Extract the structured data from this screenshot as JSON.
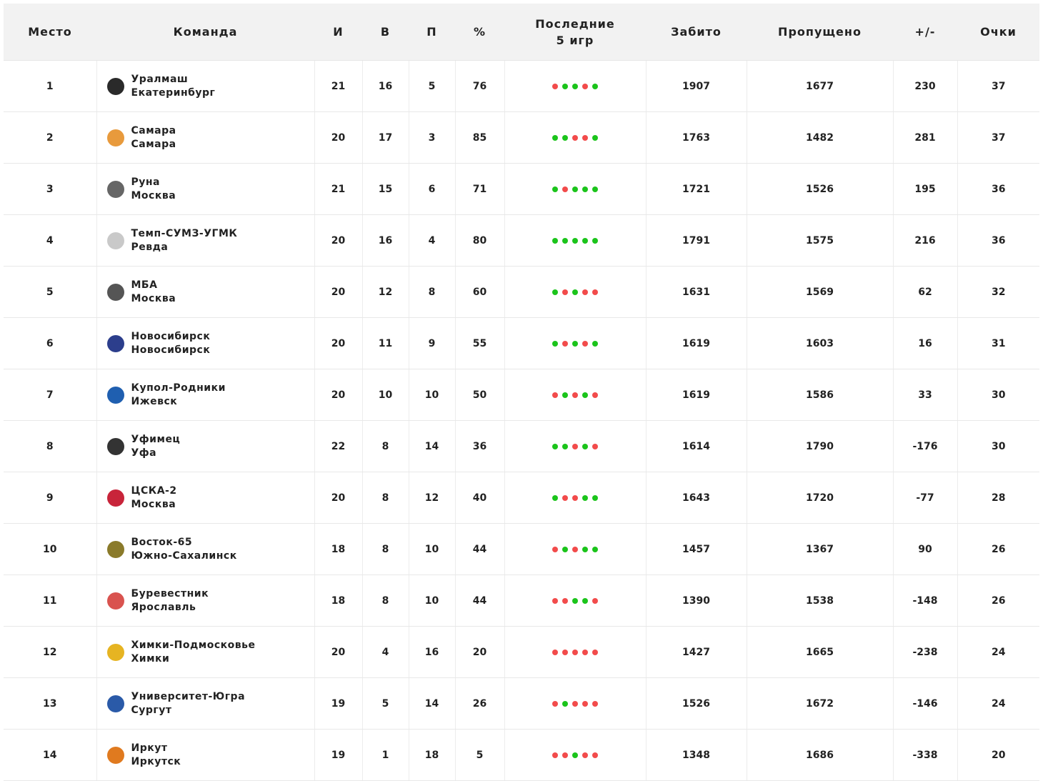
{
  "headers": [
    "Место",
    "Команда",
    "И",
    "В",
    "П",
    "%",
    "Последние 5 игр",
    "Забито",
    "Пропущено",
    "+/-",
    "Очки"
  ],
  "colors": {
    "win": "#1bc41b",
    "loss": "#f24b4b"
  },
  "rows": [
    {
      "place": "1",
      "name": "Уралмаш",
      "city": "Екатеринбург",
      "g": "21",
      "w": "16",
      "l": "5",
      "pct": "76",
      "last": "LWWLW",
      "scored": "1907",
      "conceded": "1677",
      "diff": "230",
      "pts": "37",
      "logo": "#2a2a2a"
    },
    {
      "place": "2",
      "name": "Самара",
      "city": "Самара",
      "g": "20",
      "w": "17",
      "l": "3",
      "pct": "85",
      "last": "WWLLW",
      "scored": "1763",
      "conceded": "1482",
      "diff": "281",
      "pts": "37",
      "logo": "#e89a3c"
    },
    {
      "place": "3",
      "name": "Руна",
      "city": "Москва",
      "g": "21",
      "w": "15",
      "l": "6",
      "pct": "71",
      "last": "WLWWW",
      "scored": "1721",
      "conceded": "1526",
      "diff": "195",
      "pts": "36",
      "logo": "#666666"
    },
    {
      "place": "4",
      "name": "Темп-СУМЗ-УГМК",
      "city": "Ревда",
      "g": "20",
      "w": "16",
      "l": "4",
      "pct": "80",
      "last": "WWWWW",
      "scored": "1791",
      "conceded": "1575",
      "diff": "216",
      "pts": "36",
      "logo": "#c9c9c9"
    },
    {
      "place": "5",
      "name": "МБА",
      "city": "Москва",
      "g": "20",
      "w": "12",
      "l": "8",
      "pct": "60",
      "last": "WLWLL",
      "scored": "1631",
      "conceded": "1569",
      "diff": "62",
      "pts": "32",
      "logo": "#555555"
    },
    {
      "place": "6",
      "name": "Новосибирск",
      "city": "Новосибирск",
      "g": "20",
      "w": "11",
      "l": "9",
      "pct": "55",
      "last": "WLWLW",
      "scored": "1619",
      "conceded": "1603",
      "diff": "16",
      "pts": "31",
      "logo": "#2c3e8c"
    },
    {
      "place": "7",
      "name": "Купол-Родники",
      "city": "Ижевск",
      "g": "20",
      "w": "10",
      "l": "10",
      "pct": "50",
      "last": "LWLWL",
      "scored": "1619",
      "conceded": "1586",
      "diff": "33",
      "pts": "30",
      "logo": "#1f5fb0"
    },
    {
      "place": "8",
      "name": "Уфимец",
      "city": "Уфа",
      "g": "22",
      "w": "8",
      "l": "14",
      "pct": "36",
      "last": "WWLWL",
      "scored": "1614",
      "conceded": "1790",
      "diff": "-176",
      "pts": "30",
      "logo": "#333333"
    },
    {
      "place": "9",
      "name": "ЦСКА-2",
      "city": "Москва",
      "g": "20",
      "w": "8",
      "l": "12",
      "pct": "40",
      "last": "WLLWW",
      "scored": "1643",
      "conceded": "1720",
      "diff": "-77",
      "pts": "28",
      "logo": "#c8243a"
    },
    {
      "place": "10",
      "name": "Восток-65",
      "city": "Южно-Сахалинск",
      "g": "18",
      "w": "8",
      "l": "10",
      "pct": "44",
      "last": "LWLWW",
      "scored": "1457",
      "conceded": "1367",
      "diff": "90",
      "pts": "26",
      "logo": "#8a7a2a"
    },
    {
      "place": "11",
      "name": "Буревестник",
      "city": "Ярославль",
      "g": "18",
      "w": "8",
      "l": "10",
      "pct": "44",
      "last": "LLWWL",
      "scored": "1390",
      "conceded": "1538",
      "diff": "-148",
      "pts": "26",
      "logo": "#d9534f"
    },
    {
      "place": "12",
      "name": "Химки-Подмосковье",
      "city": "Химки",
      "g": "20",
      "w": "4",
      "l": "16",
      "pct": "20",
      "last": "LLLLL",
      "scored": "1427",
      "conceded": "1665",
      "diff": "-238",
      "pts": "24",
      "logo": "#e6b422"
    },
    {
      "place": "13",
      "name": "Университет-Югра",
      "city": "Сургут",
      "g": "19",
      "w": "5",
      "l": "14",
      "pct": "26",
      "last": "LWLLL",
      "scored": "1526",
      "conceded": "1672",
      "diff": "-146",
      "pts": "24",
      "logo": "#2a5aa8"
    },
    {
      "place": "14",
      "name": "Иркут",
      "city": "Иркутск",
      "g": "19",
      "w": "1",
      "l": "18",
      "pct": "5",
      "last": "LLWLL",
      "scored": "1348",
      "conceded": "1686",
      "diff": "-338",
      "pts": "20",
      "logo": "#e07a1f"
    }
  ]
}
